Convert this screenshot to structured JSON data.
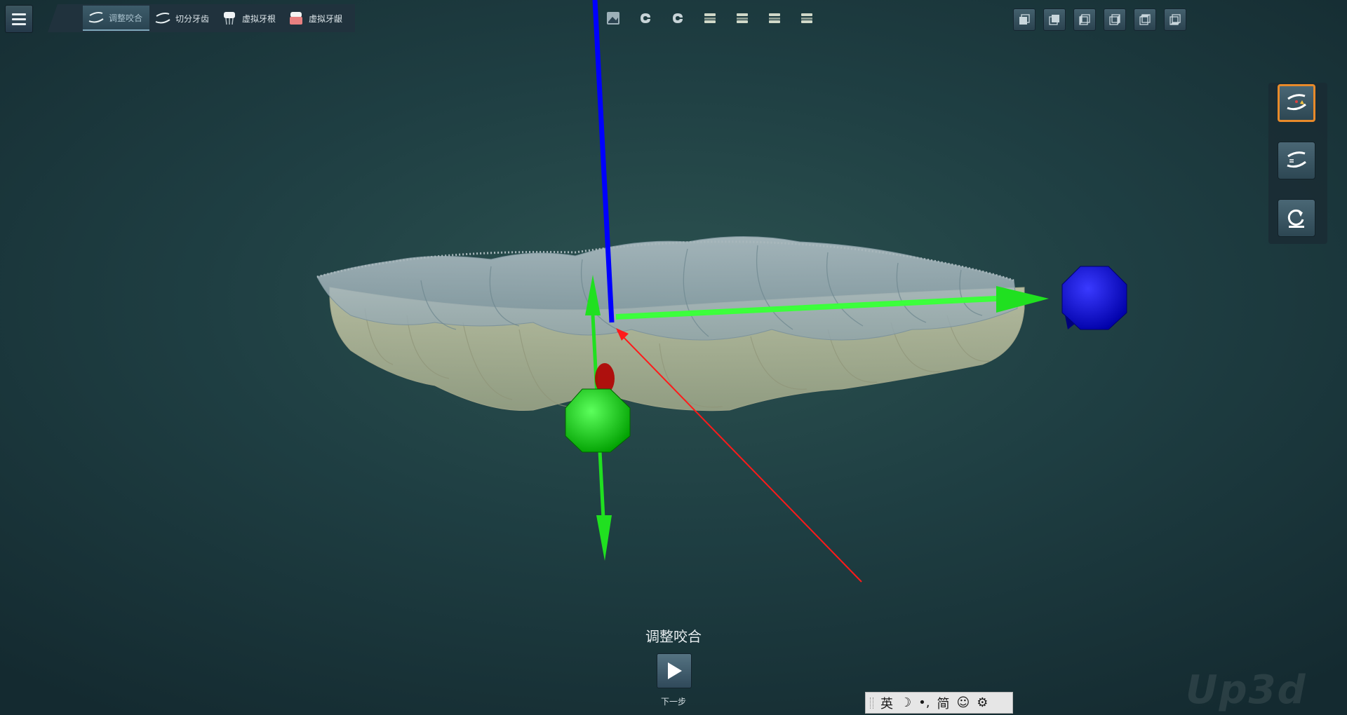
{
  "menu": {
    "icon": "hamburger-menu-icon"
  },
  "tabs": [
    {
      "label": "调整咬合",
      "icon": "adjust-bite-icon",
      "active": true
    },
    {
      "label": "切分牙齿",
      "icon": "segment-teeth-icon",
      "active": false
    },
    {
      "label": "虚拟牙根",
      "icon": "virtual-root-icon",
      "active": false
    },
    {
      "label": "虚拟牙龈",
      "icon": "virtual-gum-icon",
      "active": false
    }
  ],
  "view_toolbar": [
    "texture-toggle-icon",
    "upper-jaw-icon",
    "lower-jaw-icon",
    "show-both-jaws-icon",
    "show-upper-arch-icon",
    "show-lower-arch-icon",
    "hide-arch-icon"
  ],
  "camera_toolbar": [
    "view-front-icon",
    "view-back-icon",
    "view-left-icon",
    "view-right-icon",
    "view-top-icon",
    "view-bottom-icon"
  ],
  "side_tools": [
    {
      "icon": "auto-bite-icon",
      "active": true
    },
    {
      "icon": "swap-jaws-icon",
      "active": false
    },
    {
      "icon": "reset-icon",
      "active": false
    }
  ],
  "step": {
    "title": "调整咬合",
    "next_label": "下一步"
  },
  "ime": {
    "lang": "英",
    "moon": "☽",
    "punct": "•,",
    "simplified": "简",
    "emoji": "☺",
    "settings": "⚙"
  },
  "watermark": "Up3d",
  "colors": {
    "accent": "#e88a2a",
    "axis_x": "#00e000",
    "axis_z": "#0000ff",
    "axis_red": "#ff0000"
  }
}
